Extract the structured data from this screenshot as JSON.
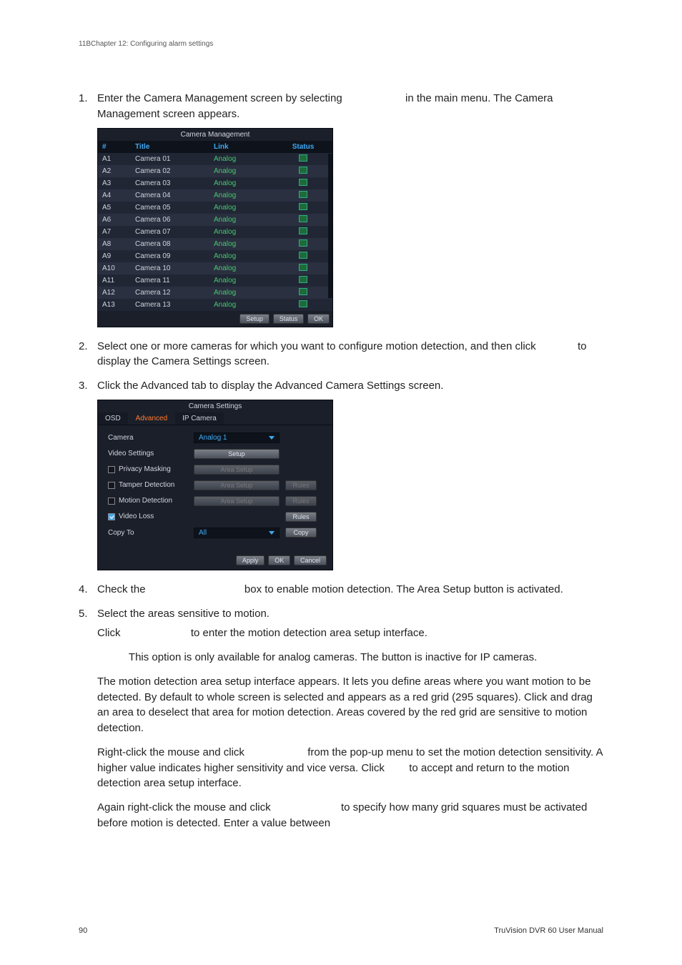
{
  "header": {
    "text": "11BChapter 12: Configuring alarm settings"
  },
  "steps": {
    "s1": {
      "num": "1.",
      "text_a": "Enter the Camera Management screen by selecting ",
      "text_b": " in the main menu. The Camera Management screen appears."
    },
    "s2": {
      "num": "2.",
      "text_a": "Select one or more cameras for which you want to configure motion detection, and then click ",
      "text_b": " to display the Camera Settings screen."
    },
    "s3": {
      "num": "3.",
      "text": "Click the Advanced tab to display the Advanced Camera Settings screen."
    },
    "s4": {
      "num": "4.",
      "text_a": "Check the ",
      "text_b": " box to enable motion detection. The Area Setup button is activated."
    },
    "s5": {
      "num": "5.",
      "text": "Select the areas sensitive to motion."
    },
    "p_click": {
      "a": "Click ",
      "b": " to enter the motion detection area setup interface."
    },
    "p_note": "This option is only available for analog cameras. The button is inactive for IP cameras.",
    "p_motion": "The motion detection area setup interface appears. It lets you define areas where you want motion to be detected. By default to whole screen is selected and appears as a red grid (295 squares). Click and drag an area to deselect that area for motion detection. Areas covered by the red grid are sensitive to motion detection.",
    "p_right": {
      "a": "Right-click the mouse and click ",
      "b": " from the pop-up menu to set the motion detection sensitivity. A higher value indicates higher sensitivity and vice versa. Click ",
      "c": " to accept and return to the motion detection area setup interface."
    },
    "p_again": {
      "a": "Again right-click the mouse and click ",
      "b": " to specify how many grid squares must be activated before motion is detected.  Enter a value between"
    }
  },
  "camera_mgmt": {
    "title": "Camera Management",
    "cols": {
      "num": "#",
      "title": "Title",
      "link": "Link",
      "status": "Status"
    },
    "rows": [
      {
        "id": "A1",
        "title": "Camera 01",
        "link": "Analog"
      },
      {
        "id": "A2",
        "title": "Camera 02",
        "link": "Analog"
      },
      {
        "id": "A3",
        "title": "Camera 03",
        "link": "Analog"
      },
      {
        "id": "A4",
        "title": "Camera 04",
        "link": "Analog"
      },
      {
        "id": "A5",
        "title": "Camera 05",
        "link": "Analog"
      },
      {
        "id": "A6",
        "title": "Camera 06",
        "link": "Analog"
      },
      {
        "id": "A7",
        "title": "Camera 07",
        "link": "Analog"
      },
      {
        "id": "A8",
        "title": "Camera 08",
        "link": "Analog"
      },
      {
        "id": "A9",
        "title": "Camera 09",
        "link": "Analog"
      },
      {
        "id": "A10",
        "title": "Camera 10",
        "link": "Analog"
      },
      {
        "id": "A11",
        "title": "Camera 11",
        "link": "Analog"
      },
      {
        "id": "A12",
        "title": "Camera 12",
        "link": "Analog"
      },
      {
        "id": "A13",
        "title": "Camera 13",
        "link": "Analog"
      }
    ],
    "buttons": {
      "setup": "Setup",
      "status": "Status",
      "ok": "OK"
    }
  },
  "camera_settings": {
    "title": "Camera Settings",
    "tabs": {
      "osd": "OSD",
      "advanced": "Advanced",
      "ip": "IP Camera"
    },
    "labels": {
      "camera": "Camera",
      "video_settings": "Video Settings",
      "privacy": "Privacy Masking",
      "tamper": "Tamper Detection",
      "motion": "Motion Detection",
      "video_loss": "Video Loss",
      "copy_to": "Copy To"
    },
    "values": {
      "camera": "Analog 1",
      "copy_to": "All"
    },
    "buttons": {
      "setup": "Setup",
      "area_setup": "Area Setup",
      "rules": "Rules",
      "copy": "Copy",
      "apply": "Apply",
      "ok": "OK",
      "cancel": "Cancel"
    }
  },
  "footer": {
    "page": "90",
    "manual": "TruVision DVR 60 User Manual"
  }
}
